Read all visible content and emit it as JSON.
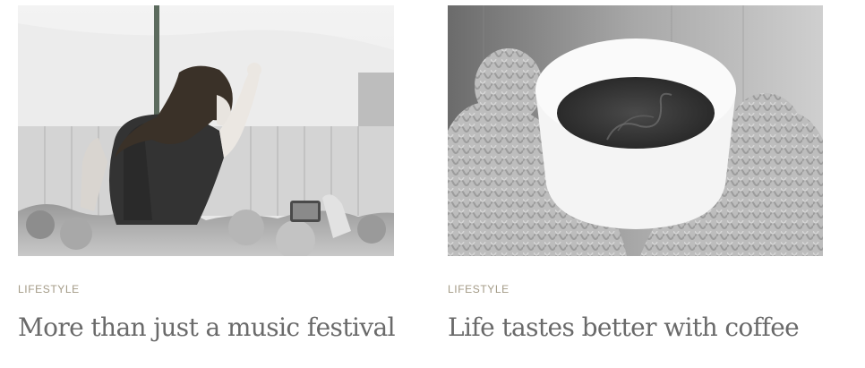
{
  "posts": [
    {
      "category": "LIFESTYLE",
      "title": "More than just a music festival",
      "image": "concert-crowd-photo"
    },
    {
      "category": "LIFESTYLE",
      "title": "Life tastes better with coffee",
      "image": "coffee-mittens-photo"
    }
  ],
  "colors": {
    "category": "#a39a86",
    "title": "#6a6a6a"
  }
}
